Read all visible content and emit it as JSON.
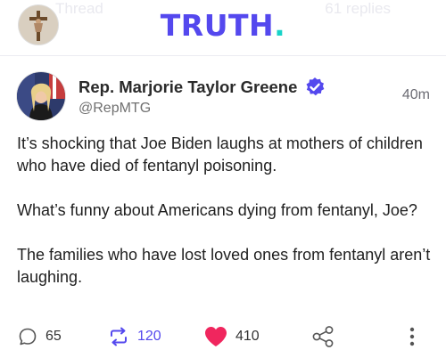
{
  "header": {
    "ghost_left": "Thread",
    "ghost_right": "61 replies",
    "logo_text": "TRUTH",
    "logo_dot": ".",
    "accent": "#5448ee",
    "dot_color": "#17d3c8"
  },
  "post": {
    "author_name": "Rep. Marjorie Taylor Greene",
    "handle": "@RepMTG",
    "time": "40m",
    "paragraphs": [
      "It’s shocking that Joe Biden laughs at mothers of children who have died of fentanyl poisoning.",
      "What’s funny about Americans dying from fentanyl, Joe?",
      "The families who have lost loved ones from fentanyl aren’t laughing."
    ],
    "verified_icon": "verified-badge-icon"
  },
  "actions": {
    "replies": "65",
    "retruths": "120",
    "likes": "410",
    "like_color": "#f0265e",
    "icons": [
      "reply-icon",
      "retruth-icon",
      "heart-icon",
      "share-icon",
      "more-vertical-icon"
    ]
  }
}
